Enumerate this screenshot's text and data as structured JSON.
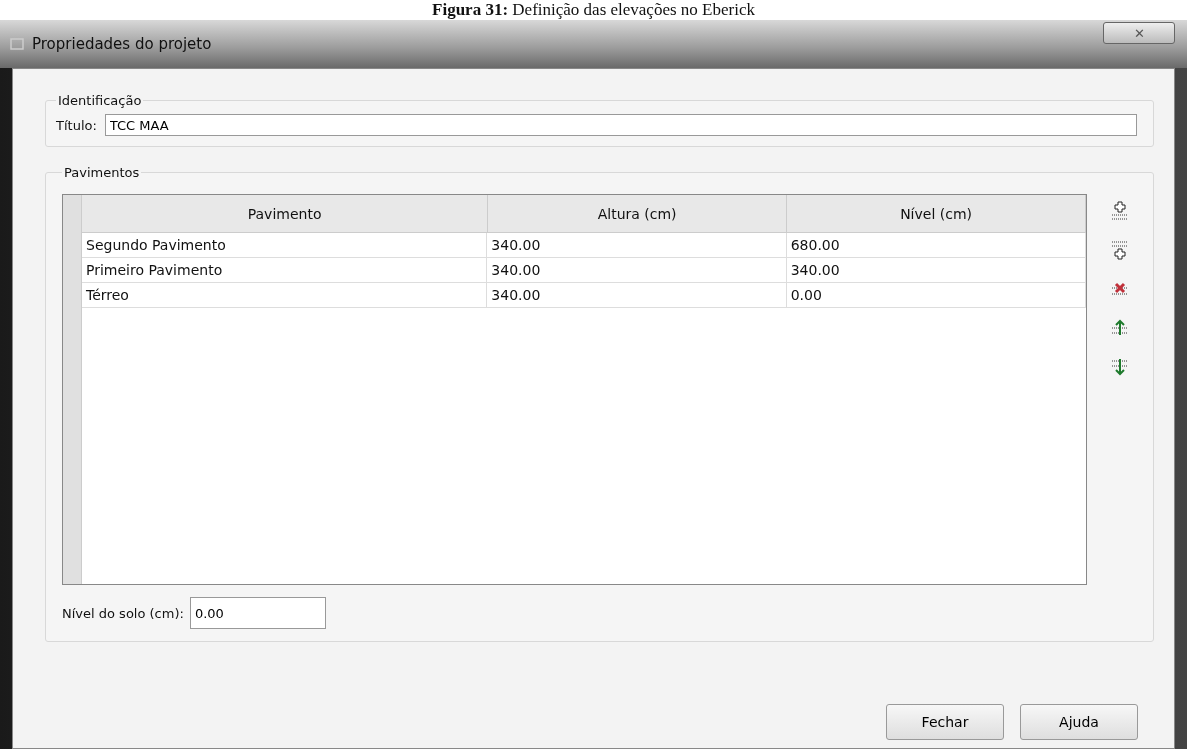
{
  "caption": {
    "label": "Figura 31:",
    "text": "Definição das elevações no Eberick"
  },
  "window": {
    "title": "Propriedades do projeto",
    "close": "✕"
  },
  "identification": {
    "legend": "Identificação",
    "title_label": "Título:",
    "title_value": "TCC MAA"
  },
  "floors": {
    "legend": "Pavimentos",
    "table": {
      "columns": [
        "Pavimento",
        "Altura (cm)",
        "Nível (cm)"
      ],
      "rows": [
        [
          "Segundo Pavimento",
          "340.00",
          "680.00"
        ],
        [
          "Primeiro Pavimento",
          "340.00",
          "340.00"
        ],
        [
          "Térreo",
          "340.00",
          "0.00"
        ]
      ]
    },
    "tools": [
      {
        "kind": "insert-above"
      },
      {
        "kind": "insert-below"
      },
      {
        "kind": "delete"
      },
      {
        "kind": "move-up"
      },
      {
        "kind": "move-down"
      }
    ],
    "ground_label": "Nível do solo (cm):",
    "ground_value": "0.00"
  },
  "buttons": [
    "Fechar",
    "Ajuda"
  ]
}
